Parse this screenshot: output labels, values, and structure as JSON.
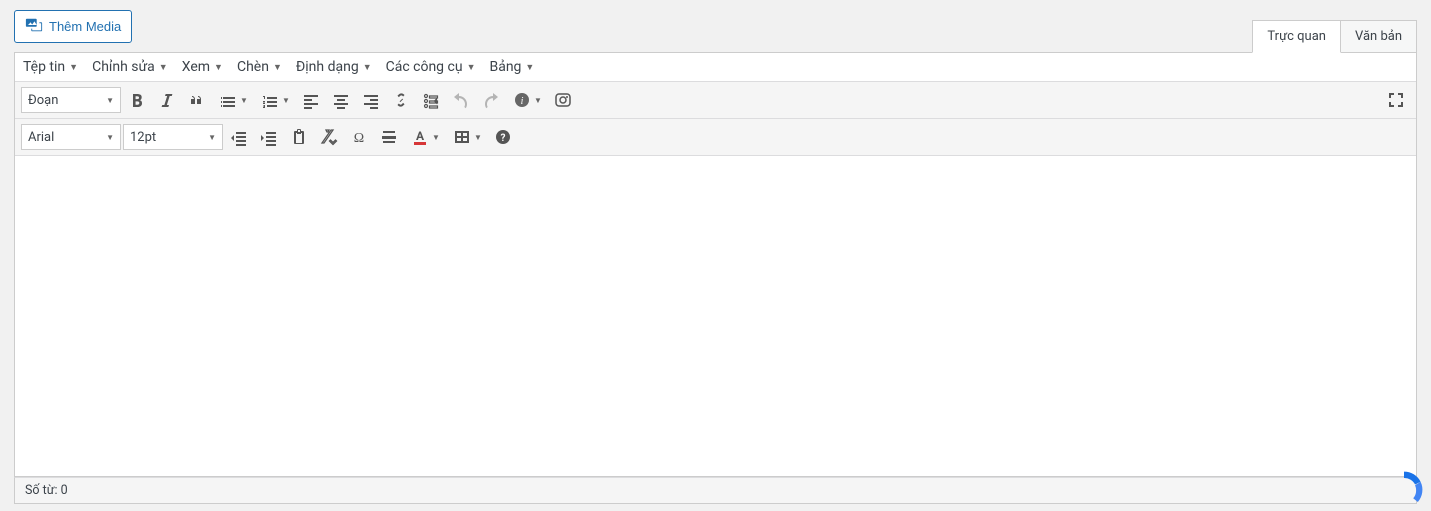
{
  "header": {
    "media_button_label": "Thêm Media"
  },
  "tabs": {
    "visual": "Trực quan",
    "text": "Văn bản"
  },
  "menubar": {
    "file": "Tệp tin",
    "edit": "Chỉnh sửa",
    "view": "Xem",
    "insert": "Chèn",
    "format": "Định dạng",
    "tools": "Các công cụ",
    "table": "Bảng"
  },
  "toolbar1": {
    "format_select": "Đoạn"
  },
  "toolbar2": {
    "font_family": "Arial",
    "font_size": "12pt"
  },
  "status": {
    "word_count_label": "Số từ:",
    "word_count_value": "0"
  },
  "icons": {
    "media": "media-icon",
    "bold": "bold-icon",
    "italic": "italic-icon",
    "blockquote": "blockquote-icon",
    "ul": "bullet-list-icon",
    "ol": "numbered-list-icon",
    "align_left": "align-left-icon",
    "align_center": "align-center-icon",
    "align_right": "align-right-icon",
    "link": "link-icon",
    "unlink": "unlink-icon",
    "undo": "undo-icon",
    "redo": "redo-icon",
    "info": "info-icon",
    "camera": "camera-icon",
    "fullscreen": "fullscreen-icon",
    "outdent": "outdent-icon",
    "indent": "indent-icon",
    "paste": "paste-icon",
    "eraser": "eraser-icon",
    "omega": "special-char-icon",
    "hr": "horizontal-rule-icon",
    "text_color": "text-color-icon",
    "table": "table-icon",
    "help": "help-icon"
  }
}
